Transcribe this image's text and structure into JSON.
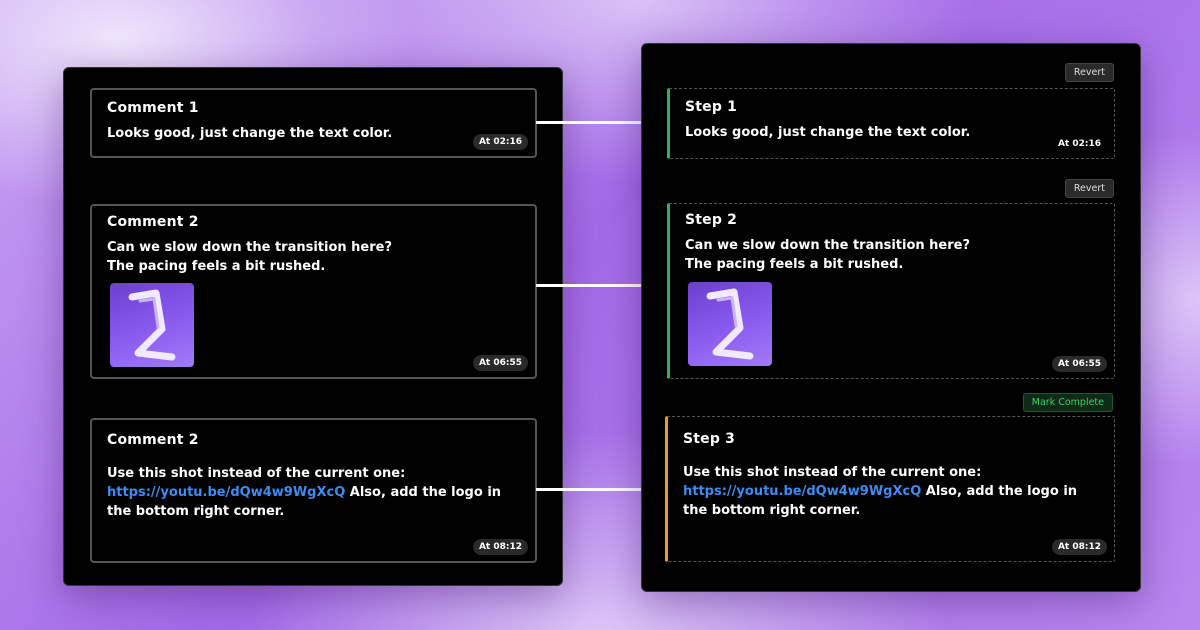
{
  "comments": [
    {
      "title": "Comment 1",
      "text": "Looks good, just change the text color.",
      "time": "At 02:16"
    },
    {
      "title": "Comment 2",
      "line1": "Can we slow down the transition here?",
      "line2": "The pacing feels a bit rushed.",
      "time": "At 06:55"
    },
    {
      "title": "Comment 2",
      "pre_link": "Use this shot instead of the current one: ",
      "link": "https://youtu.be/dQw4w9WgXcQ",
      "post_link": " Also, add the logo in the bottom right corner.",
      "time": "At 08:12"
    }
  ],
  "steps": [
    {
      "title": "Step 1",
      "text": "Looks good, just change the text color.",
      "time": "At 02:16",
      "action": "Revert",
      "status": "complete",
      "status_color": "#2fb35a"
    },
    {
      "title": "Step 2",
      "line1": "Can we slow down the transition here?",
      "line2": "The pacing feels a bit rushed.",
      "time": "At 06:55",
      "action": "Revert",
      "status": "complete",
      "status_color": "#2fb35a"
    },
    {
      "title": "Step 3",
      "pre_link": "Use this shot instead of the current one: ",
      "link": "https://youtu.be/dQw4w9WgXcQ",
      "post_link": " Also, add the logo in the bottom right corner.",
      "time": "At 08:12",
      "action": "Mark Complete",
      "status": "pending",
      "status_color": "#e8a21a"
    }
  ],
  "colors": {
    "link": "#3b8cf5",
    "complete": "#2fb35a",
    "pending": "#e8a21a",
    "mark_complete_text": "#36d36b"
  },
  "icons": {
    "thumbnail": "logo-thumbnail-icon"
  }
}
